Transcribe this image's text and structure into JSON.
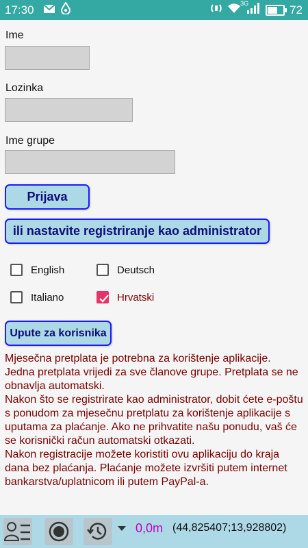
{
  "status_bar": {
    "time": "17:30",
    "signal_label": "3G",
    "battery_level": "72",
    "battery_fraction": 0.72,
    "icons": [
      "mail-icon",
      "drop-icon",
      "nfc-icon",
      "wifi-icon",
      "signal-icon",
      "battery-icon"
    ]
  },
  "form": {
    "name_label": "Ime",
    "name_value": "",
    "password_label": "Lozinka",
    "password_value": "",
    "group_label": "Ime grupe",
    "group_value": ""
  },
  "buttons": {
    "login": "Prijava",
    "register_admin": "ili nastavite registriranje kao administrator",
    "user_guide": "Upute za korisnika"
  },
  "languages": [
    {
      "label": "English",
      "checked": false
    },
    {
      "label": "Deutsch",
      "checked": false
    },
    {
      "label": "Italiano",
      "checked": false
    },
    {
      "label": "Hrvatski",
      "checked": true
    }
  ],
  "info_text": {
    "paragraph1": "Mjesečna pretplata je potrebna za korištenje aplikacije. Jedna pretplata vrijedi za sve članove grupe. Pretplata se ne obnavlja automatski.",
    "paragraph2": "Nakon što se registrirate kao administrator, dobit ćete e-poštu s ponudom za mjesečnu pretplatu za korištenje aplikacije s uputama za plaćanje. Ako ne prihvatite našu ponudu, vaš će se korisnički račun automatski otkazati.",
    "paragraph3": "Nakon registracije možete koristiti ovu aplikaciju do kraja dana bez plaćanja. Plaćanje možete izvršiti putem internet bankarstva/uplatnicom ili putem PayPal-a."
  },
  "bottom_bar": {
    "distance": "0,0m",
    "coordinates": "(44,825407;13,928802)",
    "icons": [
      "contacts-list-icon",
      "record-icon",
      "history-icon",
      "dropdown-arrow-icon"
    ]
  },
  "colors": {
    "status_bar": "#34a8a3",
    "button_bg": "#add8e6",
    "button_border": "#1a1aff",
    "info_text": "#7a0000",
    "checkbox_checked": "#e8336a",
    "distance_text": "#c000c0"
  }
}
